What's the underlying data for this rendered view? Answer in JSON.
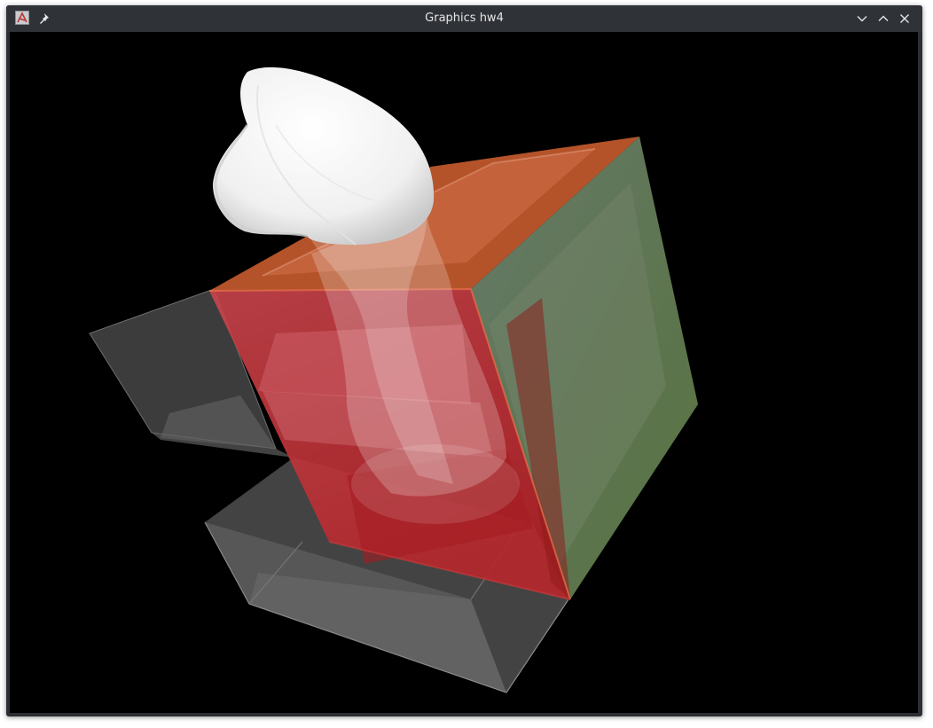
{
  "window": {
    "title": "Graphics hw4",
    "icons": {
      "app": "app-logo-icon",
      "pin": "pin-icon",
      "minimize": "chevron-down-icon",
      "maximize": "chevron-up-icon",
      "close": "close-icon"
    }
  },
  "scene": {
    "background": "#000000",
    "colors": {
      "red_face": "#d8333a",
      "orange_top": "#d96a3a",
      "green_face": "#6e8a5e",
      "gray_box": "#8a8a8a",
      "white_object": "#ffffff"
    }
  }
}
